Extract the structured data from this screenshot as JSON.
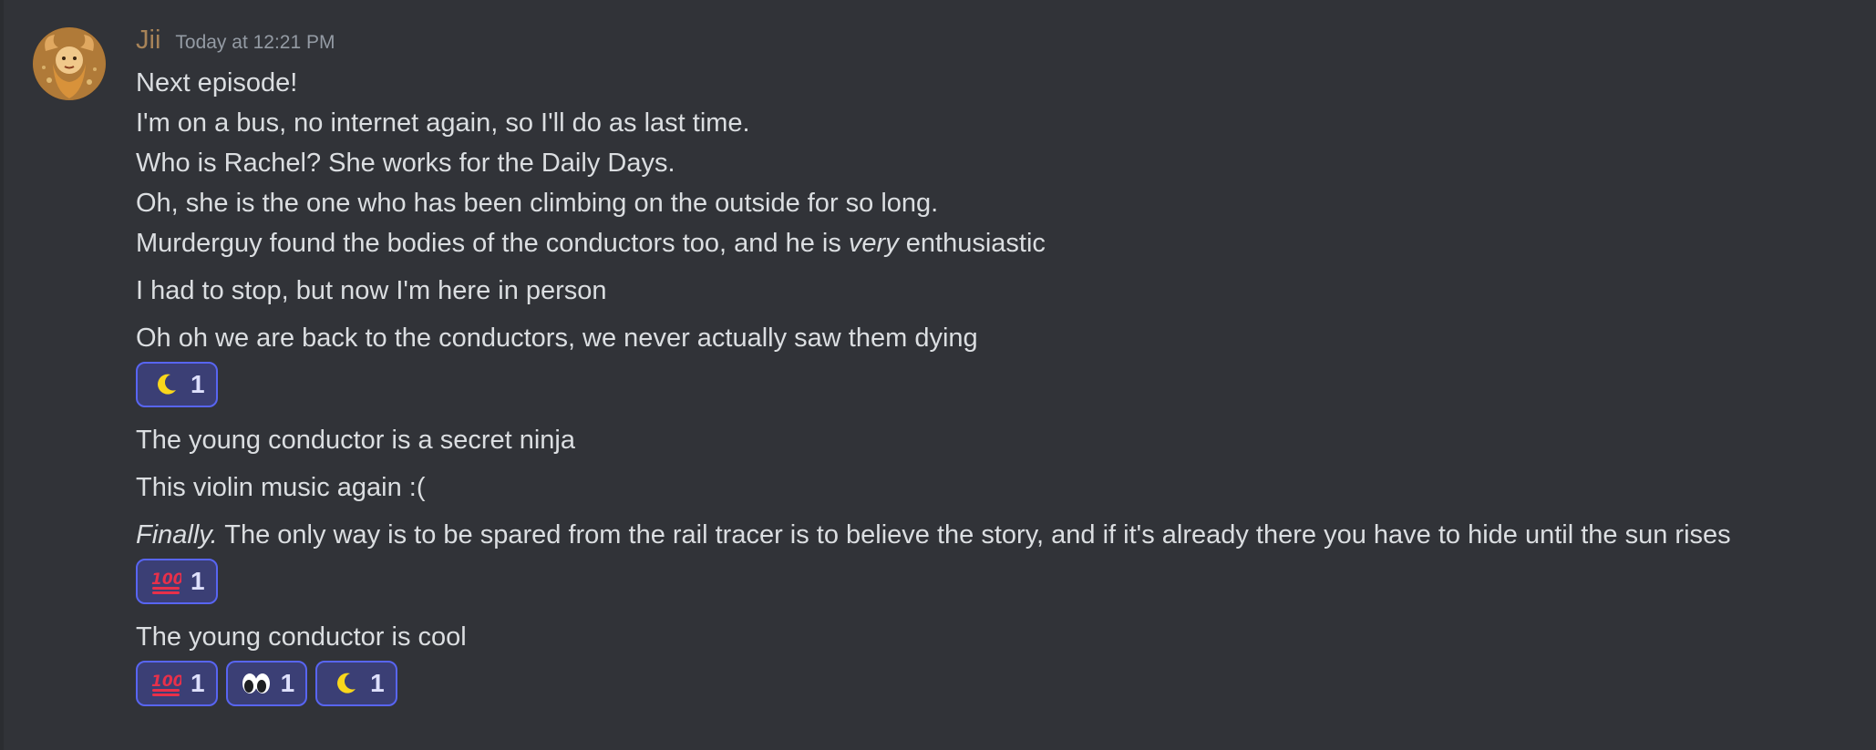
{
  "message": {
    "username": "Jii",
    "timestamp": "Today at 12:21 PM",
    "accent_color": "#a78358",
    "lines": [
      "Next episode!",
      "I'm on a bus, no internet again, so I'll do as last time.",
      "Who is Rachel? She works for the Daily Days.",
      "Oh, she is the one who has been climbing on the outside for so long.",
      {
        "before": "Murderguy found the bodies of the conductors too, and he is ",
        "em": "very",
        "after": " enthusiastic"
      },
      "I had to stop, but now I'm here in person",
      "Oh oh we are back to the conductors, we never actually saw them dying",
      "The young conductor is a secret ninja",
      "This violin music again :(",
      {
        "em": "Finally.",
        "after": " The only way is to be spared from the rail tracer is to believe the story, and if it's already there you have to hide until the sun rises"
      },
      "The young conductor is cool"
    ]
  },
  "reactions": {
    "group1": [
      {
        "icon": "crescent-moon-icon",
        "count": "1"
      }
    ],
    "group2": [
      {
        "icon": "hundred-points-icon",
        "count": "1"
      }
    ],
    "group3": [
      {
        "icon": "hundred-points-icon",
        "count": "1"
      },
      {
        "icon": "eyes-icon",
        "count": "1"
      },
      {
        "icon": "crescent-moon-icon",
        "count": "1"
      }
    ]
  },
  "colors": {
    "background": "#313338",
    "text": "#dbdee1",
    "timestamp": "#949ba4",
    "reaction_border": "#5865f2",
    "reaction_bg": "#3b3f75"
  }
}
